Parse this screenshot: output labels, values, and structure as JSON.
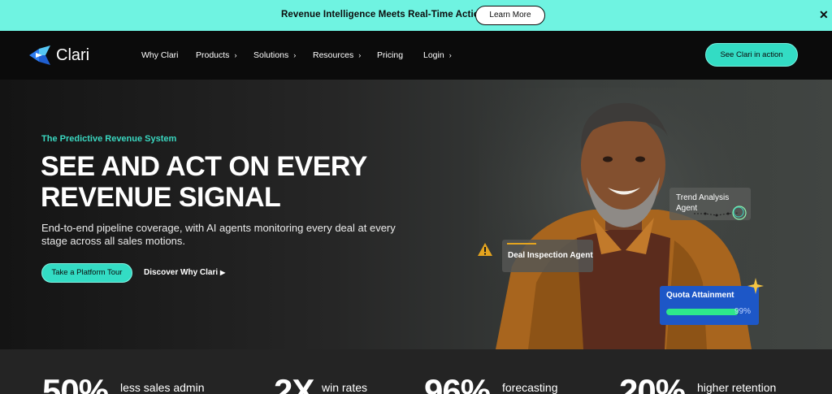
{
  "announcement": {
    "text": "Revenue Intelligence Meets Real-Time Action",
    "button": "Learn More",
    "close": "✕"
  },
  "nav": {
    "logo": "Clari",
    "items": [
      {
        "label": "Why Clari",
        "chevron": false
      },
      {
        "label": "Products",
        "chevron": true
      },
      {
        "label": "Solutions",
        "chevron": true
      },
      {
        "label": "Resources",
        "chevron": true
      },
      {
        "label": "Pricing",
        "chevron": false
      },
      {
        "label": "Login",
        "chevron": true
      }
    ],
    "cta": "See Clari in action"
  },
  "hero": {
    "eyebrow": "The Predictive Revenue System",
    "headline_line1": "SEE AND ACT ON EVERY",
    "headline_line2": "REVENUE SIGNAL",
    "subtext": "End-to-end pipeline coverage, with AI agents monitoring every deal at every stage across all sales motions.",
    "primary_button": "Take a Platform Tour",
    "secondary_link": "Discover Why Clari"
  },
  "overlays": {
    "trend_label": "Trend Analysis Agent",
    "deal_label": "Deal Inspection Agent",
    "quota_label": "Quota Attainment",
    "quota_percent": "99%",
    "quota_fraction": 0.99
  },
  "stats": [
    {
      "value": "50%",
      "label": "less sales admin"
    },
    {
      "value": "2X",
      "label": "win rates"
    },
    {
      "value": "96%",
      "label": "forecasting"
    },
    {
      "value": "20%",
      "label": "higher retention"
    }
  ],
  "colors": {
    "announce_bg": "#6ff3e1",
    "accent": "#33dcc4",
    "nav_bg": "#0b0b0b",
    "quota_card": "#1d57c7",
    "quota_fill": "#2ee88b"
  }
}
